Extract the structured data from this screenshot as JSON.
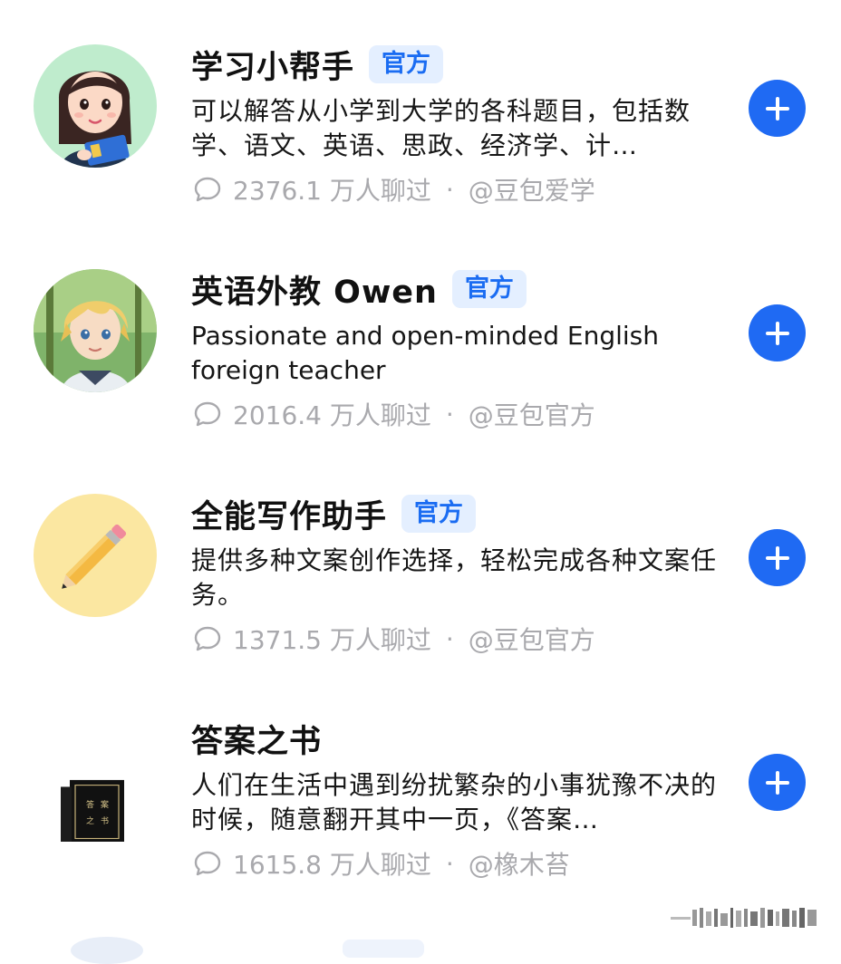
{
  "badge_label": "官方",
  "colors": {
    "accent": "#1f6af3",
    "badge_bg": "#e4efff",
    "badge_text": "#1a6cf2",
    "meta_text": "#a9a9ad"
  },
  "icons": {
    "chat": "chat-bubble-icon",
    "add": "plus-icon"
  },
  "bots": [
    {
      "name": "学习小帮手",
      "official": true,
      "description": "可以解答从小学到大学的各科题目，包括数学、语文、英语、思政、经济学、计…",
      "chat_count": "2376.1 万人聊过",
      "separator": "·",
      "author": "@豆包爱学",
      "avatar": "study-helper-avatar"
    },
    {
      "name": "英语外教 Owen",
      "official": true,
      "description": "Passionate and open-minded English foreign teacher",
      "chat_count": "2016.4 万人聊过",
      "separator": "·",
      "author": "@豆包官方",
      "avatar": "owen-avatar"
    },
    {
      "name": "全能写作助手",
      "official": true,
      "description": "提供多种文案创作选择，轻松完成各种文案任务。",
      "chat_count": "1371.5 万人聊过",
      "separator": "·",
      "author": "@豆包官方",
      "avatar": "pencil-avatar"
    },
    {
      "name": "答案之书",
      "official": false,
      "description": "人们在生活中遇到纷扰繁杂的小事犹豫不决的时候，随意翻开其中一页，《答案…",
      "chat_count": "1615.8 万人聊过",
      "separator": "·",
      "author": "@橡木苔",
      "avatar": "book-avatar"
    }
  ]
}
